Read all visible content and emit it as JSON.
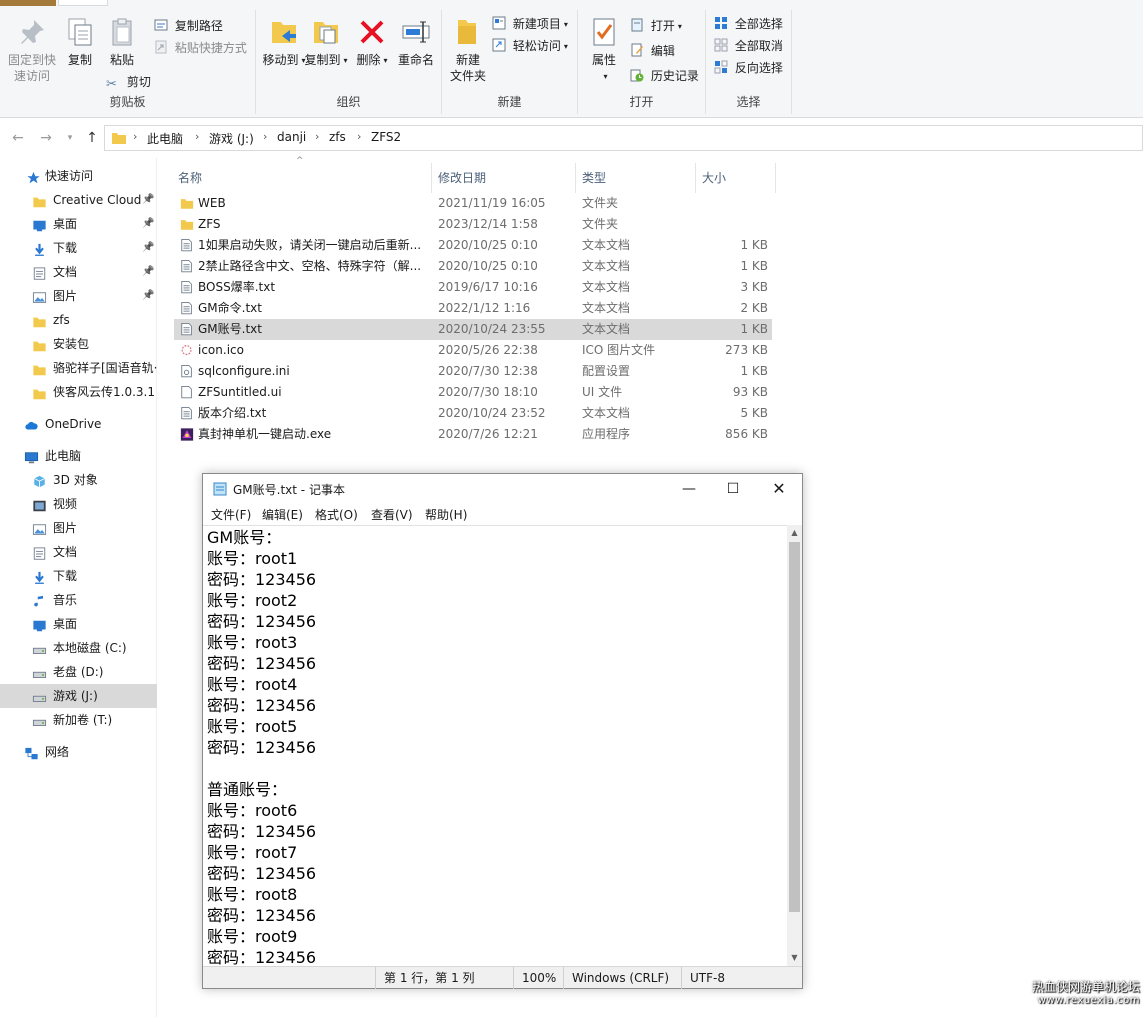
{
  "ribbon": {
    "clipboard": {
      "label": "剪贴板",
      "pin": "固定到快\n速访问",
      "pin_line1": "固定到快",
      "pin_line2": "速访问",
      "copy": "复制",
      "paste": "粘贴",
      "copy_path": "复制路径",
      "paste_shortcut": "粘贴快捷方式",
      "cut": "剪切"
    },
    "organize": {
      "label": "组织",
      "move_to": "移动到",
      "copy_to": "复制到",
      "delete": "删除",
      "rename": "重命名"
    },
    "new": {
      "label": "新建",
      "new_folder_line1": "新建",
      "new_folder_line2": "文件夹",
      "new_item": "新建项目",
      "easy_access": "轻松访问"
    },
    "open": {
      "label": "打开",
      "properties": "属性",
      "open": "打开",
      "edit": "编辑",
      "history": "历史记录"
    },
    "select": {
      "label": "选择",
      "select_all": "全部选择",
      "select_none": "全部取消",
      "invert": "反向选择"
    }
  },
  "address": {
    "crumbs": [
      "此电脑",
      "游戏 (J:)",
      "danji",
      "zfs",
      "ZFS2"
    ]
  },
  "sidebar": {
    "items": [
      {
        "label": "快速访问",
        "icon": "star-icon"
      },
      {
        "label": "Creative Cloud",
        "icon": "folder-icon"
      },
      {
        "label": "桌面",
        "icon": "desktop-icon"
      },
      {
        "label": "下载",
        "icon": "download-icon"
      },
      {
        "label": "文档",
        "icon": "document-icon"
      },
      {
        "label": "图片",
        "icon": "picture-icon"
      },
      {
        "label": "zfs",
        "icon": "folder-icon"
      },
      {
        "label": "安装包",
        "icon": "folder-icon"
      },
      {
        "label": "骆驼祥子[国语音轨·",
        "icon": "folder-icon"
      },
      {
        "label": "侠客风云传1.0.3.1",
        "icon": "folder-icon"
      },
      {
        "label": "OneDrive",
        "icon": "cloud-icon"
      },
      {
        "label": "此电脑",
        "icon": "computer-icon"
      },
      {
        "label": "3D 对象",
        "icon": "cube-icon"
      },
      {
        "label": "视频",
        "icon": "video-icon"
      },
      {
        "label": "图片",
        "icon": "picture-icon"
      },
      {
        "label": "文档",
        "icon": "document-icon"
      },
      {
        "label": "下载",
        "icon": "download-icon"
      },
      {
        "label": "音乐",
        "icon": "music-icon"
      },
      {
        "label": "桌面",
        "icon": "desktop-icon"
      },
      {
        "label": "本地磁盘 (C:)",
        "icon": "drive-icon"
      },
      {
        "label": "老盘 (D:)",
        "icon": "drive-icon"
      },
      {
        "label": "游戏 (J:)",
        "icon": "drive-icon"
      },
      {
        "label": "新加卷 (T:)",
        "icon": "drive-icon"
      },
      {
        "label": "网络",
        "icon": "network-icon"
      }
    ]
  },
  "filelist": {
    "headers": {
      "name": "名称",
      "date": "修改日期",
      "type": "类型",
      "size": "大小"
    },
    "rows": [
      {
        "name": "WEB",
        "date": "2021/11/19 16:05",
        "type": "文件夹",
        "size": "",
        "icon": "folder-icon"
      },
      {
        "name": "ZFS",
        "date": "2023/12/14 1:58",
        "type": "文件夹",
        "size": "",
        "icon": "folder-icon"
      },
      {
        "name": "1如果启动失败，请关闭一键启动后重新...",
        "date": "2020/10/25 0:10",
        "type": "文本文档",
        "size": "1 KB",
        "icon": "text-file-icon"
      },
      {
        "name": "2禁止路径含中文、空格、特殊字符（解...",
        "date": "2020/10/25 0:10",
        "type": "文本文档",
        "size": "1 KB",
        "icon": "text-file-icon"
      },
      {
        "name": "BOSS爆率.txt",
        "date": "2019/6/17 10:16",
        "type": "文本文档",
        "size": "3 KB",
        "icon": "text-file-icon"
      },
      {
        "name": "GM命令.txt",
        "date": "2022/1/12 1:16",
        "type": "文本文档",
        "size": "2 KB",
        "icon": "text-file-icon"
      },
      {
        "name": "GM账号.txt",
        "date": "2020/10/24 23:55",
        "type": "文本文档",
        "size": "1 KB",
        "icon": "text-file-icon"
      },
      {
        "name": "icon.ico",
        "date": "2020/5/26 22:38",
        "type": "ICO 图片文件",
        "size": "273 KB",
        "icon": "ico-file-icon"
      },
      {
        "name": "sqlconfigure.ini",
        "date": "2020/7/30 12:38",
        "type": "配置设置",
        "size": "1 KB",
        "icon": "ini-file-icon"
      },
      {
        "name": "ZFSuntitled.ui",
        "date": "2020/7/30 18:10",
        "type": "UI 文件",
        "size": "93 KB",
        "icon": "blank-file-icon"
      },
      {
        "name": "版本介绍.txt",
        "date": "2020/10/24 23:52",
        "type": "文本文档",
        "size": "5 KB",
        "icon": "text-file-icon"
      },
      {
        "name": "真封神单机一键启动.exe",
        "date": "2020/7/26 12:21",
        "type": "应用程序",
        "size": "856 KB",
        "icon": "exe-icon"
      }
    ]
  },
  "notepad": {
    "title": "GM账号.txt - 记事本",
    "menu": [
      "文件(F)",
      "编辑(E)",
      "格式(O)",
      "查看(V)",
      "帮助(H)"
    ],
    "lines": [
      "GM账号：",
      "账号：root1",
      "密码：123456",
      "账号：root2",
      "密码：123456",
      "账号：root3",
      "密码：123456",
      "账号：root4",
      "密码：123456",
      "账号：root5",
      "密码：123456",
      "",
      "普通账号：",
      "账号：root6",
      "密码：123456",
      "账号：root7",
      "密码：123456",
      "账号：root8",
      "密码：123456",
      "账号：root9",
      "密码：123456"
    ],
    "status": {
      "position": "第 1 行，第 1 列",
      "zoom": "100%",
      "line_ending": "Windows (CRLF)",
      "encoding": "UTF-8"
    }
  },
  "watermark": {
    "line1": "热血侠网游单机论坛",
    "line2": "www.rexuexia.com"
  },
  "colors": {
    "folder": "#f2c94c",
    "selection": "#d9d9d9",
    "accent": "#0078d7"
  }
}
